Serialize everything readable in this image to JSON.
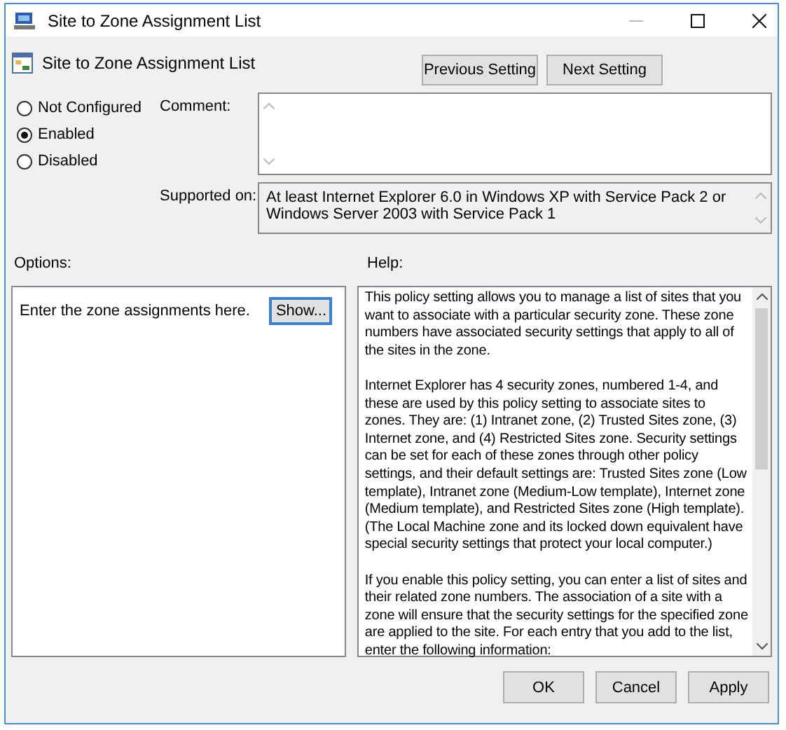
{
  "window": {
    "title": "Site to Zone Assignment List"
  },
  "setting": {
    "title": "Site to Zone Assignment List"
  },
  "nav_buttons": [
    "Previous Setting",
    "Next Setting"
  ],
  "states": [
    {
      "label": "Not Configured",
      "selected": false
    },
    {
      "label": "Enabled",
      "selected": true
    },
    {
      "label": "Disabled",
      "selected": false
    }
  ],
  "comment": {
    "label": "Comment:"
  },
  "supported_on": {
    "label": "Supported on:",
    "value": "At least Internet Explorer 6.0 in Windows XP with Service Pack 2 or Windows Server 2003 with Service Pack 1"
  },
  "options": {
    "label": "Options:",
    "text": "Enter the zone assignments here.",
    "button": "Show..."
  },
  "help": {
    "label": "Help:",
    "paragraphs": [
      "This policy setting allows you to manage a list of sites that you want to associate with a particular security zone. These zone numbers have associated security settings that apply to all of the sites in the zone.",
      "Internet Explorer has 4 security zones, numbered 1-4, and these are used by this policy setting to associate sites to zones. They are: (1) Intranet zone, (2) Trusted Sites zone, (3) Internet zone, and (4) Restricted Sites zone. Security settings can be set for each of these zones through other policy settings, and their default settings are: Trusted Sites zone (Low template), Intranet zone (Medium-Low template), Internet zone (Medium template), and Restricted Sites zone (High template). (The Local Machine zone and its locked down equivalent have special security settings that protect your local computer.)",
      "If you enable this policy setting, you can enter a list of sites and their related zone numbers. The association of a site with a zone will ensure that the security settings for the specified zone are applied to the site.  For each entry that you add to the list, enter the following information:"
    ]
  },
  "footer_buttons": [
    "OK",
    "Cancel",
    "Apply"
  ]
}
